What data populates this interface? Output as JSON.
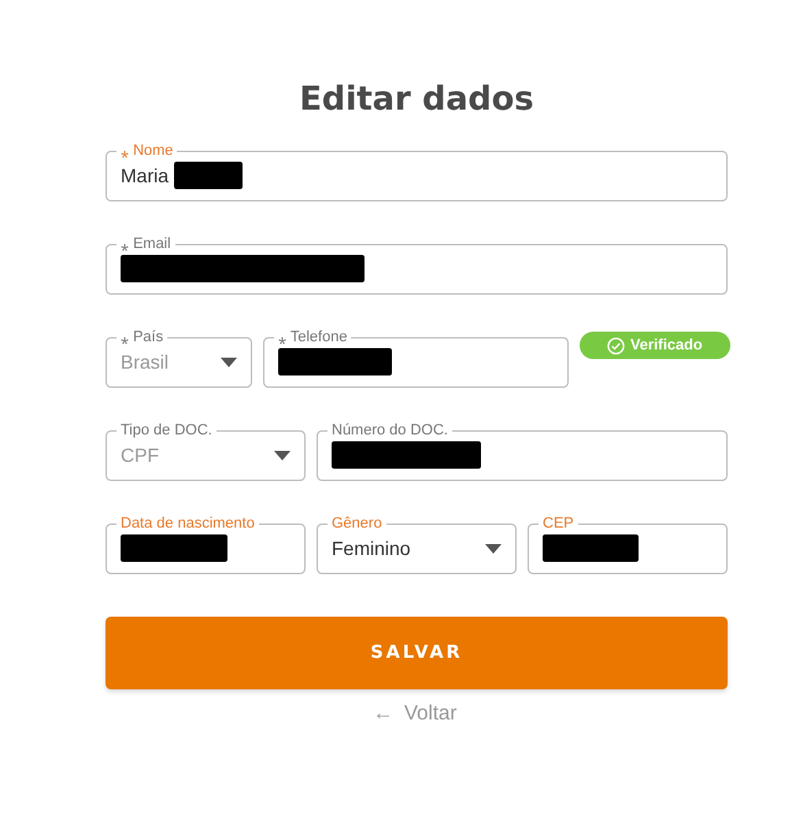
{
  "title": "Editar dados",
  "rows": [
    [
      {
        "label": "Nome",
        "marker": "⁎",
        "highlighted": true,
        "kind": "text",
        "value": "Maria",
        "redacted": true,
        "disabled": false
      }
    ],
    [
      {
        "label": "Email",
        "marker": "⁎",
        "highlighted": false,
        "kind": "text",
        "redacted": true
      }
    ],
    [
      {
        "label": "País",
        "marker": "⁎",
        "highlighted": false,
        "kind": "select",
        "value": "Brasil",
        "disabled": true
      },
      {
        "label": "Telefone",
        "marker": "⁎",
        "highlighted": false,
        "kind": "text",
        "redacted": true,
        "badge": {
          "label": "Verificado"
        }
      }
    ],
    [
      {
        "label": "Tipo de DOC.",
        "highlighted": false,
        "kind": "select",
        "value": "CPF",
        "disabled": true
      },
      {
        "label": "Número do DOC.",
        "highlighted": false,
        "kind": "text",
        "redacted": true
      }
    ],
    [
      {
        "label": "Data de nascimento",
        "highlighted": true,
        "kind": "text",
        "redacted": true
      },
      {
        "label": "Gênero",
        "highlighted": true,
        "kind": "select",
        "value": "Feminino",
        "disabled": false
      },
      {
        "label": "CEP",
        "highlighted": true,
        "kind": "text",
        "redacted": true
      }
    ]
  ],
  "submit": {
    "label": "SALVAR"
  },
  "back": {
    "arrow": "←",
    "label": "Voltar"
  }
}
